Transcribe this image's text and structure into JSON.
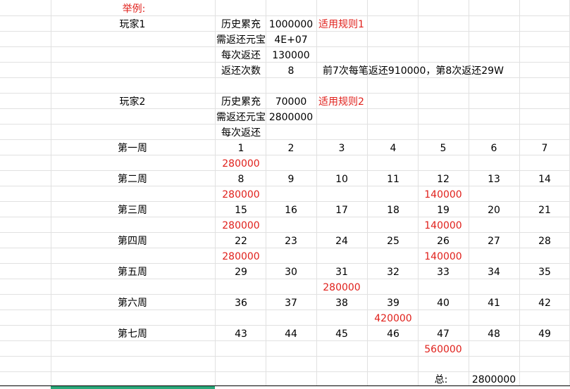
{
  "example_label": "举例:",
  "player1": {
    "name": "玩家1",
    "rows": [
      {
        "label": "历史累充",
        "value": "1000000",
        "note": "适用规则1"
      },
      {
        "label": "需返还元宝",
        "value": "4E+07",
        "note": ""
      },
      {
        "label": "每次返还",
        "value": "130000",
        "note": ""
      },
      {
        "label": "返还次数",
        "value": "8",
        "note": ""
      }
    ],
    "remark": "前7次每笔返还910000，第8次返还29W"
  },
  "player2": {
    "name": "玩家2",
    "rows": [
      {
        "label": "历史累充",
        "value": "70000",
        "note": "适用规则2"
      },
      {
        "label": "需返还元宝",
        "value": "2800000",
        "note": ""
      },
      {
        "label": "每次返还",
        "value": "",
        "note": ""
      }
    ]
  },
  "weeks": [
    {
      "label": "第一周",
      "days": [
        "1",
        "2",
        "3",
        "4",
        "5",
        "6",
        "7"
      ],
      "payouts": [
        "280000",
        "",
        "",
        "",
        "",
        "",
        ""
      ]
    },
    {
      "label": "第二周",
      "days": [
        "8",
        "9",
        "10",
        "11",
        "12",
        "13",
        "14"
      ],
      "payouts": [
        "280000",
        "",
        "",
        "",
        "140000",
        "",
        ""
      ]
    },
    {
      "label": "第三周",
      "days": [
        "15",
        "16",
        "17",
        "18",
        "19",
        "20",
        "21"
      ],
      "payouts": [
        "280000",
        "",
        "",
        "",
        "140000",
        "",
        ""
      ]
    },
    {
      "label": "第四周",
      "days": [
        "22",
        "23",
        "24",
        "25",
        "26",
        "27",
        "28"
      ],
      "payouts": [
        "280000",
        "",
        "",
        "",
        "140000",
        "",
        ""
      ]
    },
    {
      "label": "第五周",
      "days": [
        "29",
        "30",
        "31",
        "32",
        "33",
        "34",
        "35"
      ],
      "payouts": [
        "",
        "",
        "280000",
        "",
        "",
        "",
        ""
      ]
    },
    {
      "label": "第六周",
      "days": [
        "36",
        "37",
        "38",
        "39",
        "40",
        "41",
        "42"
      ],
      "payouts": [
        "",
        "",
        "",
        "420000",
        "",
        "",
        ""
      ]
    },
    {
      "label": "第七周",
      "days": [
        "43",
        "44",
        "45",
        "46",
        "47",
        "48",
        "49"
      ],
      "payouts": [
        "",
        "",
        "",
        "",
        "560000",
        "",
        ""
      ]
    }
  ],
  "total": {
    "label": "总:",
    "value": "2800000"
  },
  "colors": {
    "red_text": "#e0201b",
    "grid": "#e1e1e1",
    "accent": "#2aa87a"
  }
}
